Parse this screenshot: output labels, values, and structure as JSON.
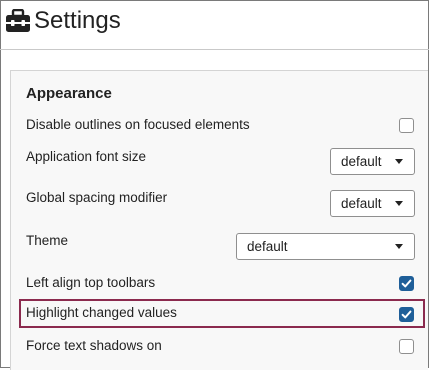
{
  "header": {
    "title": "Settings",
    "icon": "toolbox-icon"
  },
  "appearance": {
    "section_title": "Appearance",
    "disable_outlines": {
      "label": "Disable outlines on focused elements",
      "checked": false
    },
    "app_font_size": {
      "label": "Application font size",
      "value": "default"
    },
    "spacing_modifier": {
      "label": "Global spacing modifier",
      "value": "default"
    },
    "theme": {
      "label": "Theme",
      "value": "default"
    },
    "left_align_toolbars": {
      "label": "Left align top toolbars",
      "checked": true
    },
    "highlight_changed": {
      "label": "Highlight changed values",
      "checked": true,
      "highlighted": true
    },
    "force_text_shadows": {
      "label": "Force text shadows on",
      "checked": false
    }
  },
  "colors": {
    "accent": "#1f5f99",
    "highlight_border": "#8b2a4e",
    "panel_background": "#f8f8f8"
  }
}
